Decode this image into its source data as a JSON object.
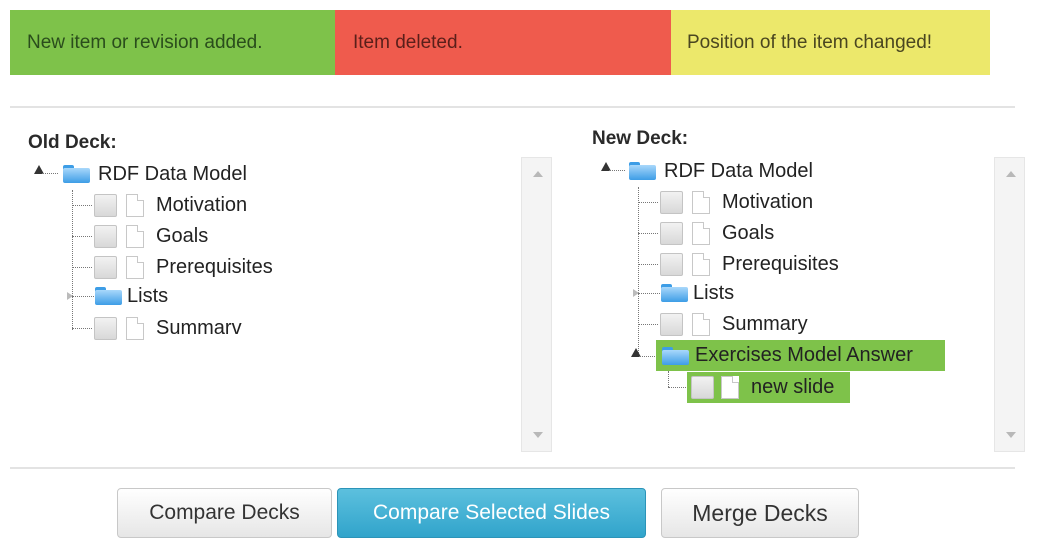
{
  "legend": {
    "added": "New item or revision added.",
    "deleted": "Item deleted.",
    "moved": "Position of the item changed!",
    "colors": {
      "added": "#7ec24a",
      "deleted": "#ef5b4d",
      "moved": "#ece86b"
    }
  },
  "old_deck": {
    "title": "Old Deck:",
    "root": "RDF Data Model",
    "items": [
      "Motivation",
      "Goals",
      "Prerequisites",
      "Lists",
      "Summarv"
    ]
  },
  "new_deck": {
    "title": "New Deck:",
    "root": "RDF Data Model",
    "items": [
      "Motivation",
      "Goals",
      "Prerequisites",
      "Lists",
      "Summary"
    ],
    "added_folder": "Exercises Model Answer",
    "added_slide": "new slide",
    "highlight_color": "#7ec24a"
  },
  "buttons": {
    "compare_decks": "Compare Decks",
    "compare_selected": "Compare Selected Slides",
    "merge": "Merge Decks"
  },
  "icons": {
    "folder": "folder-icon",
    "slide": "slide-file-icon",
    "checkbox": "checkbox-icon",
    "scroll_up": "chevron-up-icon",
    "scroll_down": "chevron-down-icon"
  }
}
